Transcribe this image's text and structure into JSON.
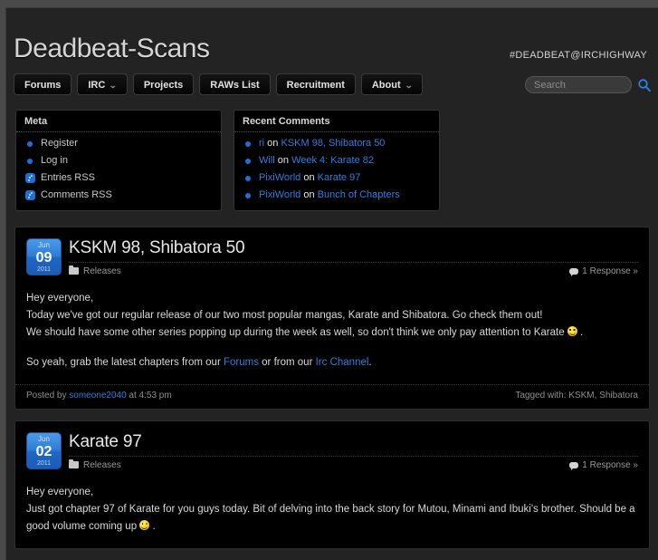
{
  "header": {
    "site_title": "Deadbeat-Scans",
    "irc_tag": "#DEADBEAT@IRCHIGHWAY"
  },
  "nav": {
    "items": [
      {
        "label": "Forums",
        "caret": false
      },
      {
        "label": "IRC",
        "caret": true
      },
      {
        "label": "Projects",
        "caret": false
      },
      {
        "label": "RAWs List",
        "caret": false
      },
      {
        "label": "Recruitment",
        "caret": false
      },
      {
        "label": "About",
        "caret": true
      }
    ],
    "caret_glyph": "⌄"
  },
  "search": {
    "placeholder": "Search",
    "value": "",
    "icon": "search-icon"
  },
  "widgets": [
    {
      "id": "meta",
      "title": "Meta",
      "items": [
        {
          "label": "Register",
          "icon": "bullet"
        },
        {
          "label": "Log in",
          "icon": "bullet"
        },
        {
          "label": "Entries RSS",
          "icon": "rss-icon"
        },
        {
          "label": "Comments RSS",
          "icon": "rss-icon"
        }
      ]
    },
    {
      "id": "recent-comments",
      "title": "Recent Comments",
      "items": [
        {
          "author": "ri",
          "on": "on",
          "post": "KSKM 98, Shibatora 50"
        },
        {
          "author": "Will",
          "on": "on",
          "post": "Week 4: Karate 82"
        },
        {
          "author": "PixiWorld",
          "on": "on",
          "post": "Karate 97"
        },
        {
          "author": "PixiWorld",
          "on": "on",
          "post": "Bunch of Chapters"
        }
      ]
    }
  ],
  "posts": [
    {
      "date": {
        "month": "Jun",
        "day": "09",
        "year": "2011"
      },
      "title": "KSKM 98, Shibatora 50",
      "category": "Releases",
      "responses": "1 Response »",
      "paragraphs": [
        {
          "lines": [
            [
              {
                "t": "Hey everyone,"
              }
            ],
            [
              {
                "t": "Today we've got our regular release of our two most popular mangas, Karate and Shibatora. Go check them out!"
              }
            ],
            [
              {
                "t": "We should have some other series popping up during the week as well, so don't think we only pay attention to Karate "
              },
              {
                "smiley": true
              },
              {
                "t": " ."
              }
            ]
          ]
        },
        {
          "lines": [
            [
              {
                "t": "So yeah, grab the latest chapters from our "
              },
              {
                "t": "Forums",
                "link": true
              },
              {
                "t": " or from our "
              },
              {
                "t": "Irc Channel",
                "link": true
              },
              {
                "t": "."
              }
            ]
          ]
        }
      ],
      "footer": {
        "posted_prefix": "Posted by",
        "author": "someone2040",
        "posted_suffix": "at 4:53 pm",
        "tagged_label": "Tagged with:",
        "tags": "KSKM, Shibatora"
      }
    },
    {
      "date": {
        "month": "Jun",
        "day": "02",
        "year": "2011"
      },
      "title": "Karate 97",
      "category": "Releases",
      "responses": "1 Response »",
      "paragraphs": [
        {
          "lines": [
            [
              {
                "t": "Hey everyone,"
              }
            ],
            [
              {
                "t": "Just got chapter 97 of Karate for you guys today. Bit of delving into the back story for Mutou, Minami and Ibuki's brother. Should be a good volume coming up "
              },
              {
                "smiley": true
              },
              {
                "t": " ."
              }
            ]
          ]
        }
      ],
      "footer": null
    }
  ],
  "colors": {
    "accent_blue": "#2f7fe0",
    "page_bg": "#232323",
    "outer_bg": "#4a4a4a",
    "post_bg": "#000000"
  }
}
